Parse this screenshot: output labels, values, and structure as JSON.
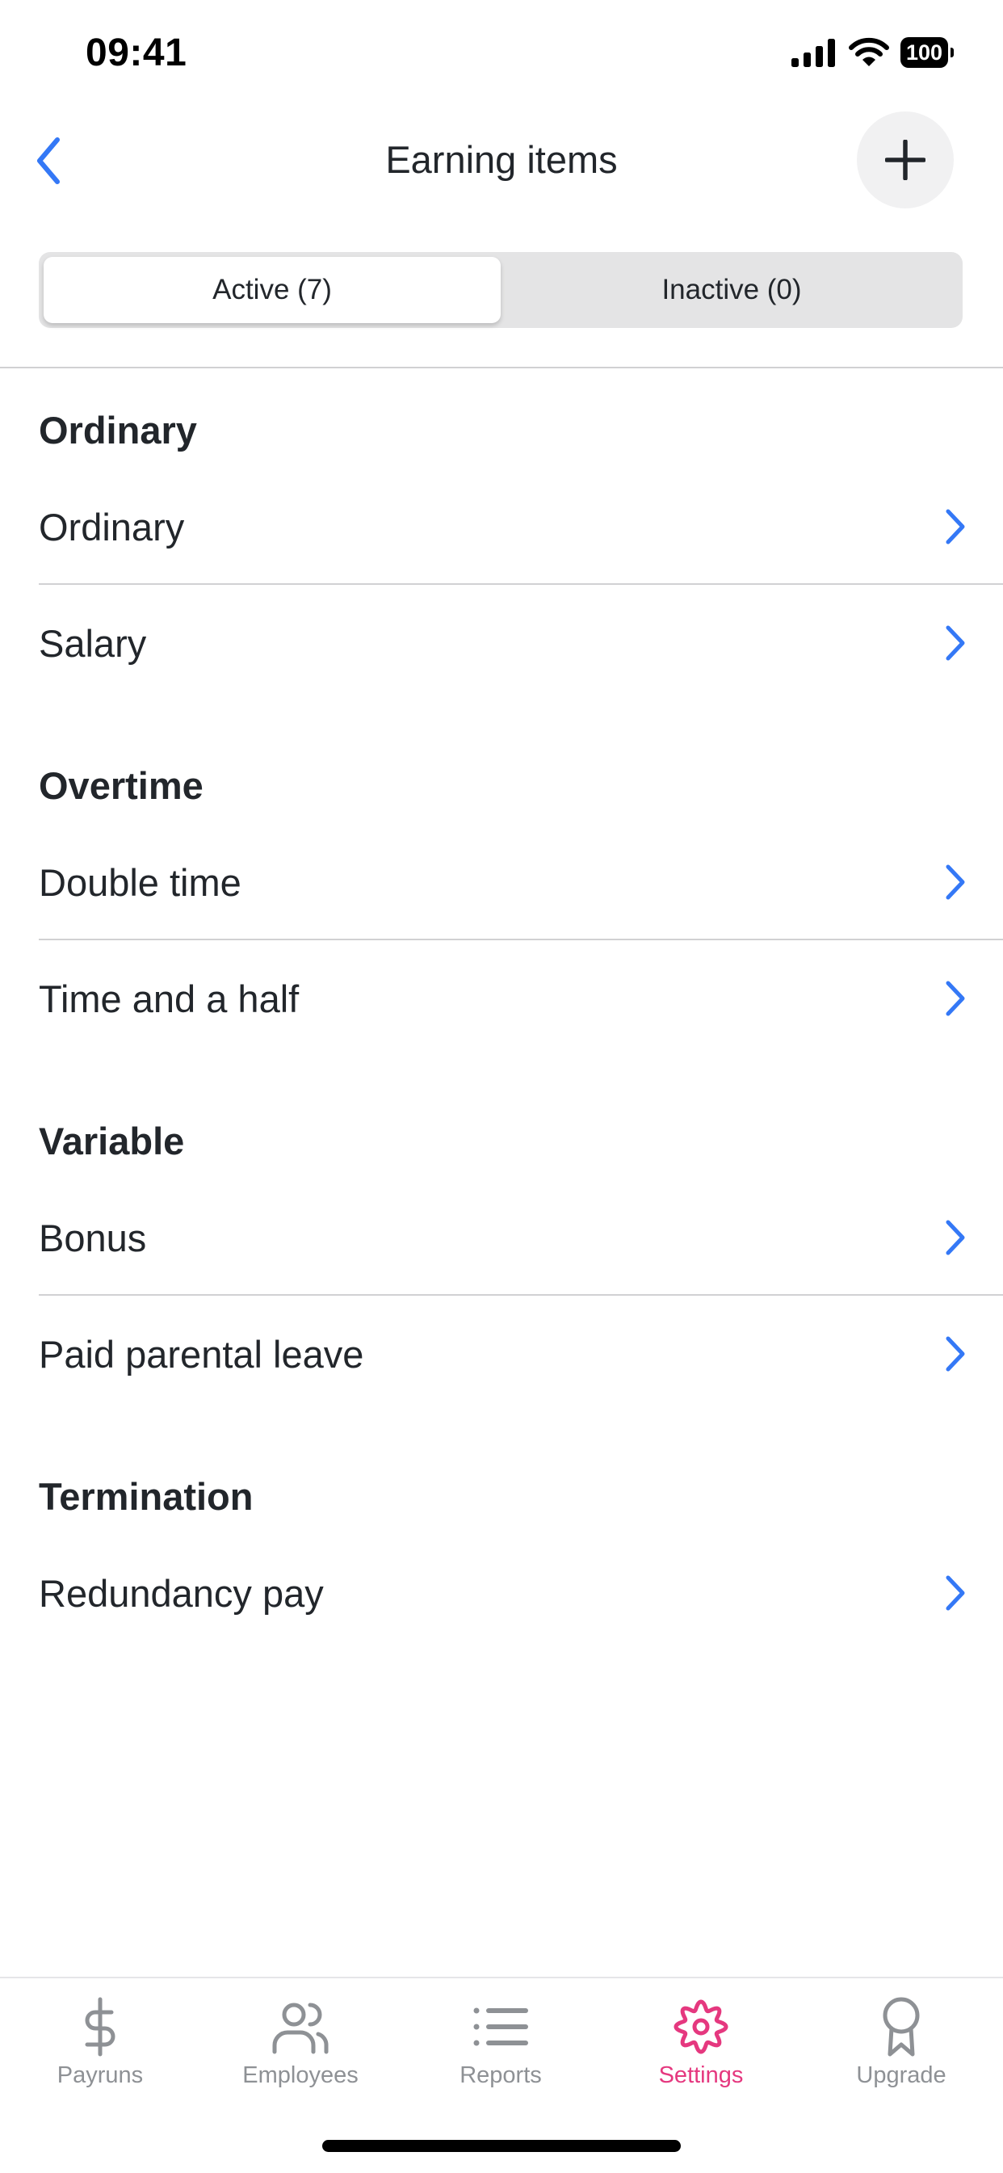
{
  "status_bar": {
    "time": "09:41",
    "battery": "100",
    "icons": [
      "cellular-signal-icon",
      "wifi-icon",
      "battery-icon"
    ]
  },
  "nav": {
    "title": "Earning items",
    "back_icon": "chevron-left-icon",
    "add_icon": "plus-icon"
  },
  "segmented_control": {
    "selected": "Active (7)",
    "segments": [
      {
        "label": "Active (7)",
        "active": true
      },
      {
        "label": "Inactive (0)",
        "active": false
      }
    ]
  },
  "sections": [
    {
      "title": "Ordinary",
      "items": [
        {
          "label": "Ordinary"
        },
        {
          "label": "Salary"
        }
      ]
    },
    {
      "title": "Overtime",
      "items": [
        {
          "label": "Double time"
        },
        {
          "label": "Time and a half"
        }
      ]
    },
    {
      "title": "Variable",
      "items": [
        {
          "label": "Bonus"
        },
        {
          "label": "Paid parental leave"
        }
      ]
    },
    {
      "title": "Termination",
      "items": [
        {
          "label": "Redundancy pay"
        }
      ]
    }
  ],
  "tab_bar": {
    "active": "Settings",
    "tabs": [
      {
        "label": "Payruns",
        "icon": "dollar-icon"
      },
      {
        "label": "Employees",
        "icon": "people-icon"
      },
      {
        "label": "Reports",
        "icon": "list-icon"
      },
      {
        "label": "Settings",
        "icon": "gear-icon"
      },
      {
        "label": "Upgrade",
        "icon": "award-ribbon-icon"
      }
    ]
  },
  "colors": {
    "accent": "#3478f6",
    "active_tab": "#e5387f",
    "inactive_tab": "#8e9195",
    "text": "#22262b",
    "separator": "#d1d1d3",
    "segment_bg": "#e4e4e5",
    "add_button_bg": "#f1f1f2"
  }
}
